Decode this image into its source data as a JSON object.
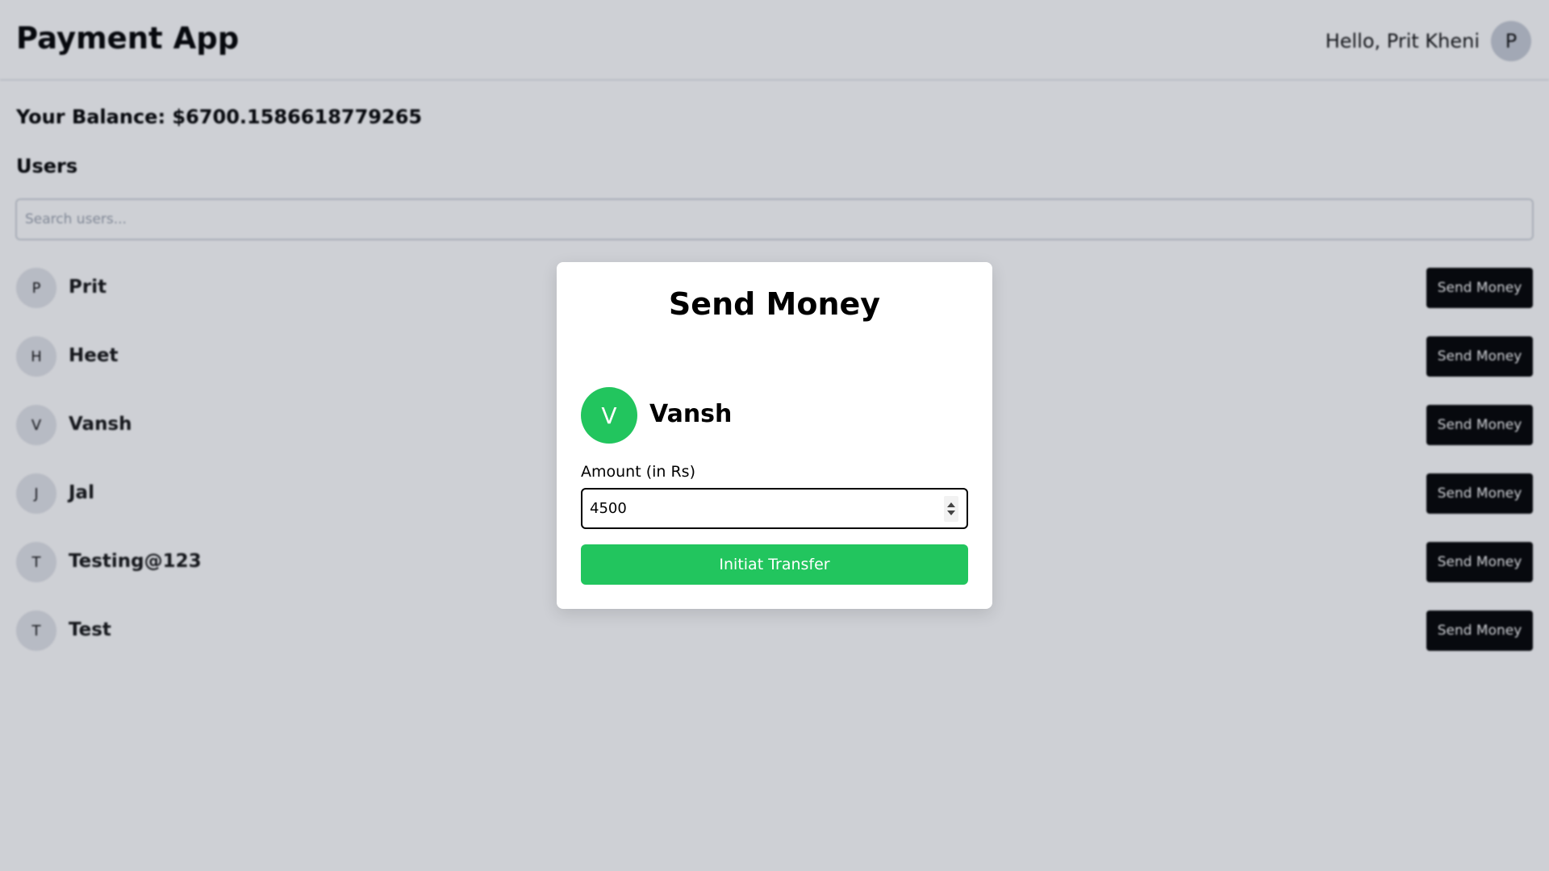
{
  "header": {
    "title": "Payment App",
    "greeting": "Hello, Prit Kheni",
    "avatar_initial": "P"
  },
  "balance": {
    "text": "Your Balance: $6700.1586618779265"
  },
  "users": {
    "heading": "Users",
    "search_placeholder": "Search users...",
    "send_label": "Send Money",
    "items": [
      {
        "initial": "P",
        "name": "Prit"
      },
      {
        "initial": "H",
        "name": "Heet"
      },
      {
        "initial": "V",
        "name": "Vansh"
      },
      {
        "initial": "J",
        "name": "Jal"
      },
      {
        "initial": "T",
        "name": "Testing@123"
      },
      {
        "initial": "T",
        "name": "Test"
      }
    ]
  },
  "modal": {
    "title": "Send Money",
    "recipient_initial": "V",
    "recipient_name": "Vansh",
    "amount_label": "Amount (in Rs)",
    "amount_value": "4500",
    "transfer_label": "Initiat Transfer"
  },
  "colors": {
    "accent_green": "#22c55e",
    "button_black": "#000000"
  }
}
